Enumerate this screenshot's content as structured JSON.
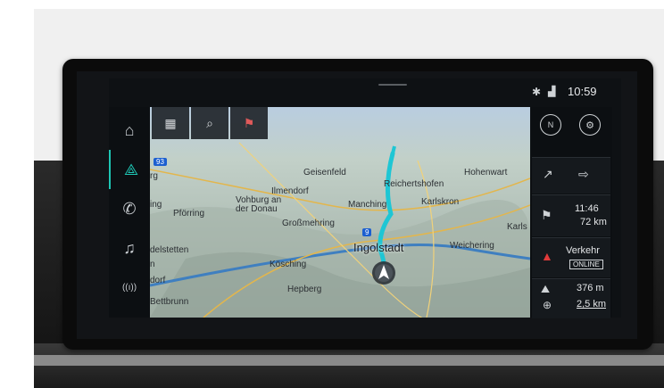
{
  "status": {
    "bluetooth_icon": "bluetooth-icon",
    "signal_icon": "signal-icon",
    "clock": "10:59"
  },
  "leftnav": {
    "items": [
      {
        "name": "home",
        "icon": "⌂"
      },
      {
        "name": "navigation",
        "icon": "⟁"
      },
      {
        "name": "phone",
        "icon": "✆"
      },
      {
        "name": "media",
        "icon": "♫"
      },
      {
        "name": "radio",
        "icon": "((ı))"
      }
    ]
  },
  "toolbar": {
    "grid_icon": "▦",
    "search_icon": "⌕",
    "destination_icon": "⚑"
  },
  "map": {
    "labels": {
      "road_93": "93",
      "rg": "rg",
      "geisenfeld": "Geisenfeld",
      "hohenwart": "Hohenwart",
      "ilmendorf": "Ilmendorf",
      "reichertshofen": "Reichertshofen",
      "ing": "ing",
      "pforring": "Pförring",
      "vohburg": "Vohburg an der Donau",
      "manching": "Manching",
      "karlskron": "Karlskron",
      "grossmehring": "Großmehring",
      "karls": "Karls",
      "road_9": "9",
      "delstetten": "delstetten",
      "ingolstadt": "Ingolstadt",
      "weichering": "Weichering",
      "n": "n",
      "kosching": "Kösching",
      "dorf": "dorf",
      "hepberg": "Hepberg",
      "bettbrunn": "Bettbrunn"
    }
  },
  "rightpanel": {
    "compass": "N",
    "settings_icon": "⚙",
    "route_icon": "↗",
    "route_options_icon": "⇨",
    "arrival_time": "11:46",
    "remaining_distance": "72 km",
    "traffic_label": "Verkehr",
    "traffic_status": "ONLINE",
    "altitude": "376 m",
    "zoom_scale": "2,5 km"
  }
}
